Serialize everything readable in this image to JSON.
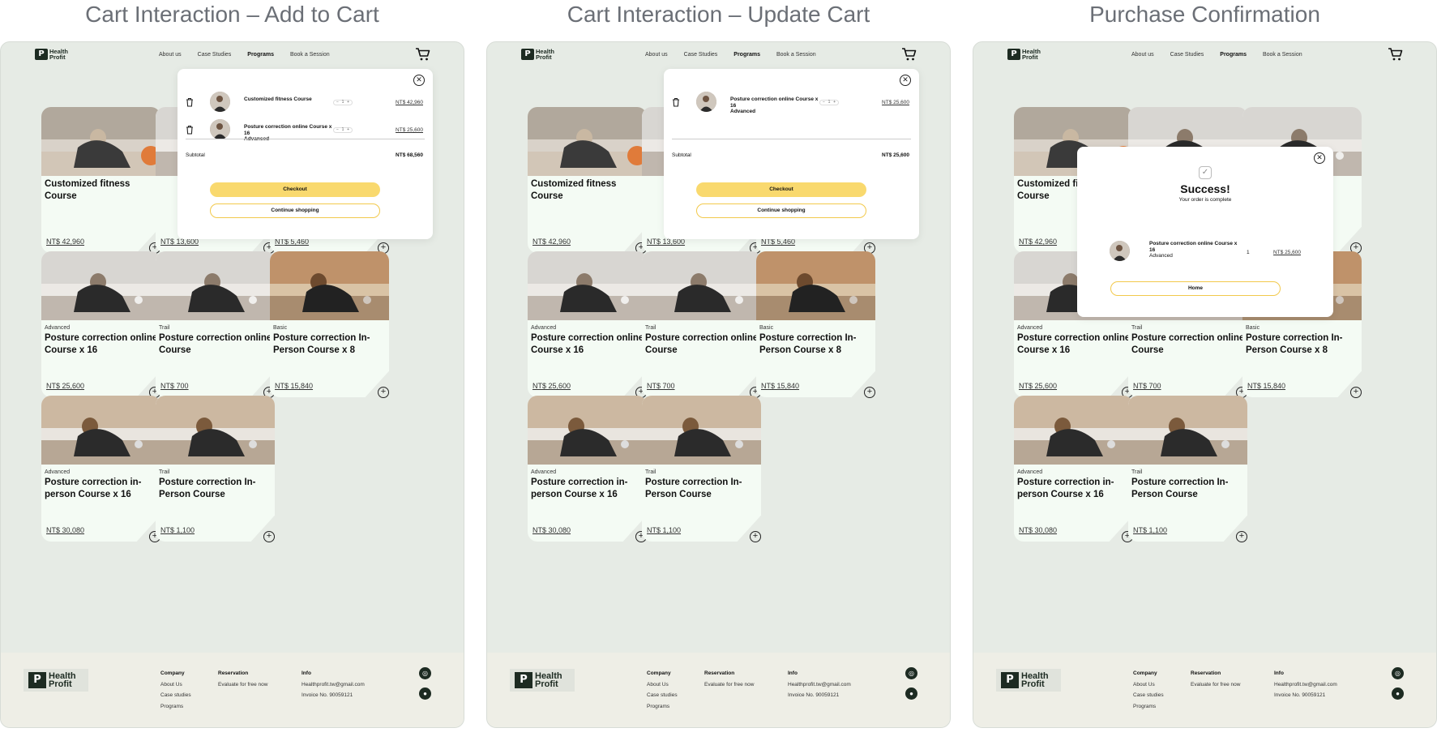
{
  "titles": [
    "Cart Interaction – Add to Cart",
    "Cart Interaction – Update Cart",
    "Purchase Confirmation"
  ],
  "brand": {
    "line1": "Health",
    "line2": "Profit",
    "mark": "P"
  },
  "nav": {
    "about": "About us",
    "case": "Case Studies",
    "programs": "Programs",
    "book": "Book a Session"
  },
  "cards": [
    {
      "level": "",
      "name": "Customized fitness Course",
      "price": "NT$ 42,960"
    },
    {
      "level": "",
      "name": "",
      "price": "NT$ 13,600"
    },
    {
      "level": "",
      "name": "",
      "price": "NT$ 5,460"
    },
    {
      "level": "Advanced",
      "name": "Posture correction online Course x 16",
      "price": "NT$ 25,600"
    },
    {
      "level": "Trail",
      "name": "Posture correction online Course",
      "price": "NT$ 700"
    },
    {
      "level": "Basic",
      "name": "Posture correction In-Person Course x 8",
      "price": "NT$ 15,840"
    },
    {
      "level": "Advanced",
      "name": "Posture correction in-person Course x 16",
      "price": "NT$ 30,080"
    },
    {
      "level": "Trail",
      "name": "Posture correction In-Person Course",
      "price": "NT$ 1,100"
    }
  ],
  "p3_top": {
    "name1": "Customized",
    "name2": "Course",
    "name3": "online"
  },
  "cart1": {
    "items": [
      {
        "name": "Customized fitness Course",
        "qty": "1",
        "price": "NT$ 42,960"
      },
      {
        "name": "Posture correction online Course x 16",
        "level": "Advanced",
        "qty": "1",
        "price": "NT$ 25,600"
      }
    ],
    "subtotal_label": "Subtotal",
    "subtotal": "NT$ 68,560",
    "checkout": "Checkout",
    "continue": "Continue shopping"
  },
  "cart2": {
    "items": [
      {
        "name": "Posture correction online Course x 16",
        "level": "Advanced",
        "qty": "1",
        "price": "NT$ 25,600"
      }
    ],
    "subtotal_label": "Subtotal",
    "subtotal": "NT$ 25,600",
    "checkout": "Checkout",
    "continue": "Continue shopping"
  },
  "success": {
    "title": "Success!",
    "subtitle": "Your order is complete",
    "item_name": "Posture correction online Course x 16",
    "item_level": "Advanced",
    "qty": "1",
    "price": "NT$ 25,600",
    "home": "Home"
  },
  "footer": {
    "company": "Company",
    "about": "About Us",
    "case": "Case studies",
    "programs": "Programs",
    "reservation": "Reservation",
    "evaluate": "Evaluate for free now",
    "info": "Info",
    "email": "Healthprofit.tw@gmail.com",
    "invoice": "Invoice No. 90059121"
  },
  "colors": {
    "bg": "#e6ebe5",
    "card": "#f4fbf4",
    "accent": "#f9d96e",
    "dark": "#1d2b22"
  }
}
